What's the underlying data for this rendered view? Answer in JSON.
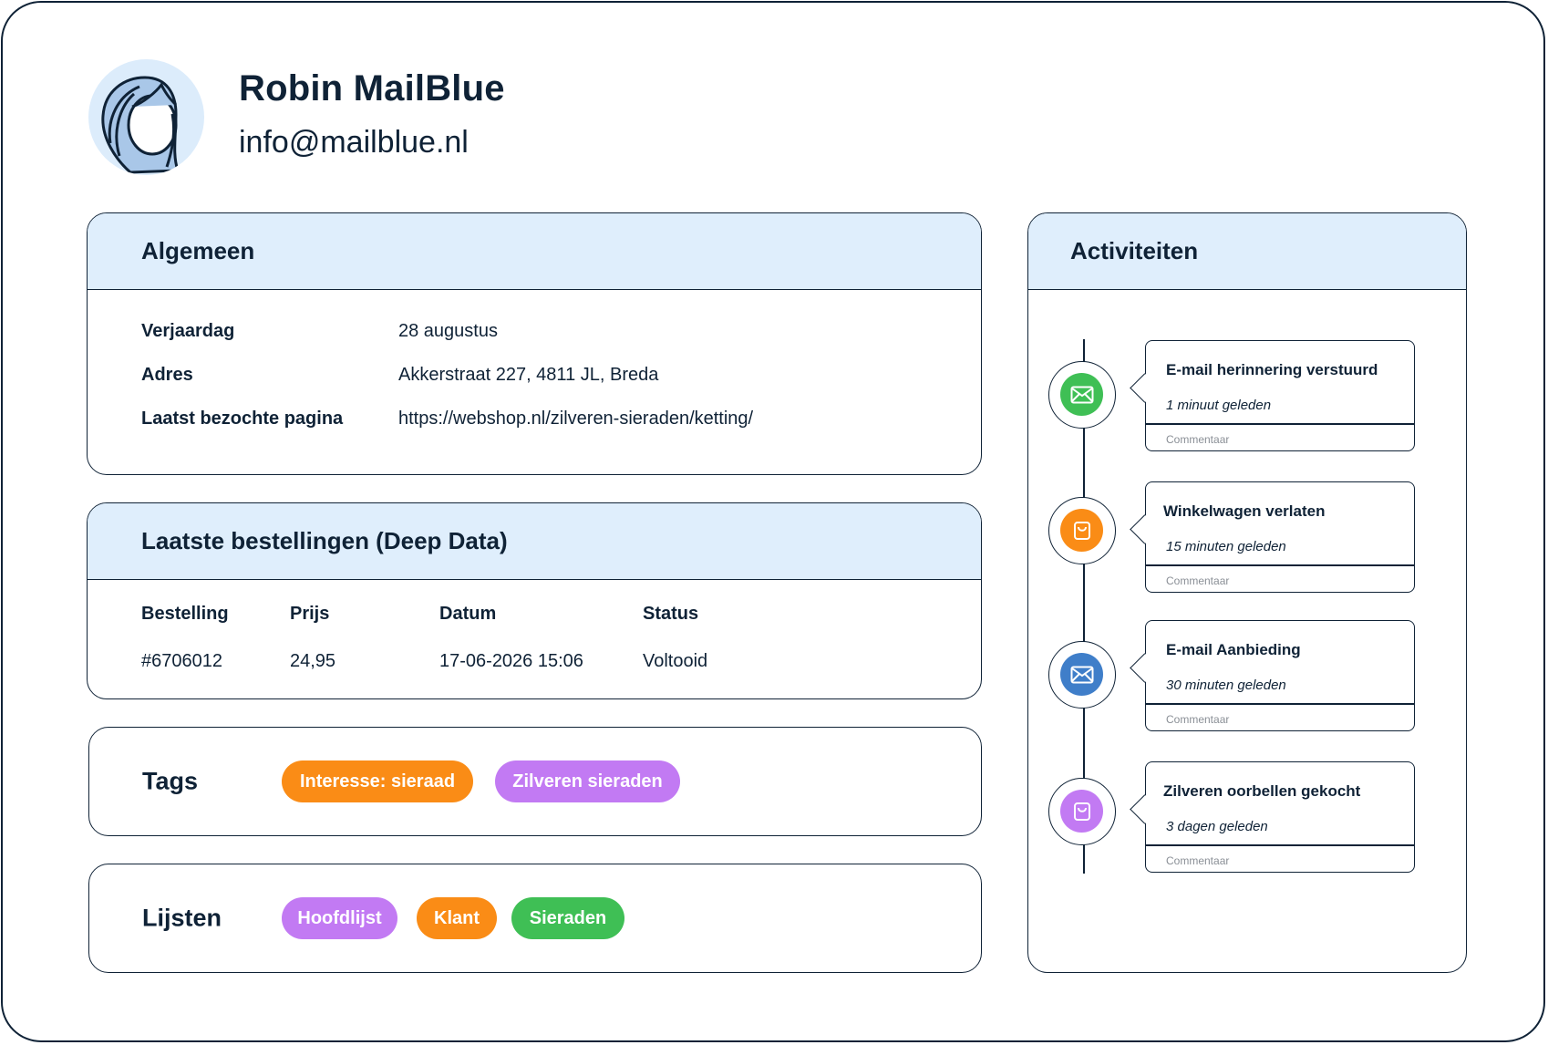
{
  "profile": {
    "name": "Robin MailBlue",
    "email": "info@mailblue.nl",
    "avatar_icon": "person-avatar-icon"
  },
  "general": {
    "title": "Algemeen",
    "fields": [
      {
        "label": "Verjaardag",
        "value": "28 augustus"
      },
      {
        "label": "Adres",
        "value": "Akkerstraat 227, 4811 JL, Breda"
      },
      {
        "label": "Laatst bezochte pagina",
        "value": "https://webshop.nl/zilveren-sieraden/ketting/"
      }
    ]
  },
  "orders": {
    "title": "Laatste bestellingen (Deep Data)",
    "columns": [
      "Bestelling",
      "Prijs",
      "Datum",
      "Status"
    ],
    "rows": [
      [
        "#6706012",
        "24,95",
        "17-06-2026 15:06",
        "Voltooid"
      ]
    ]
  },
  "tags": {
    "label": "Tags",
    "items": [
      {
        "text": "Interesse: sieraad",
        "color": "#fa8c16"
      },
      {
        "text": "Zilveren sieraden",
        "color": "#c27af3"
      }
    ]
  },
  "lists": {
    "label": "Lijsten",
    "items": [
      {
        "text": "Hoofdlijst",
        "color": "#c27af3"
      },
      {
        "text": "Klant",
        "color": "#fa8c16"
      },
      {
        "text": "Sieraden",
        "color": "#3fbf55"
      }
    ]
  },
  "activities": {
    "title": "Activiteiten",
    "comment_placeholder": "Commentaar",
    "items": [
      {
        "title": "E-mail herinnering verstuurd",
        "time": "1 minuut geleden",
        "icon": "envelope-icon",
        "color": "#3fbf55"
      },
      {
        "title": "Winkelwagen verlaten",
        "time": "15 minuten geleden",
        "icon": "shopping-bag-icon",
        "color": "#fa8c16"
      },
      {
        "title": "E-mail Aanbieding",
        "time": "30 minuten geleden",
        "icon": "envelope-icon",
        "color": "#3f7ec9"
      },
      {
        "title": "Zilveren oorbellen gekocht",
        "time": "3 dagen geleden",
        "icon": "shopping-bag-icon",
        "color": "#c27af3"
      }
    ]
  }
}
